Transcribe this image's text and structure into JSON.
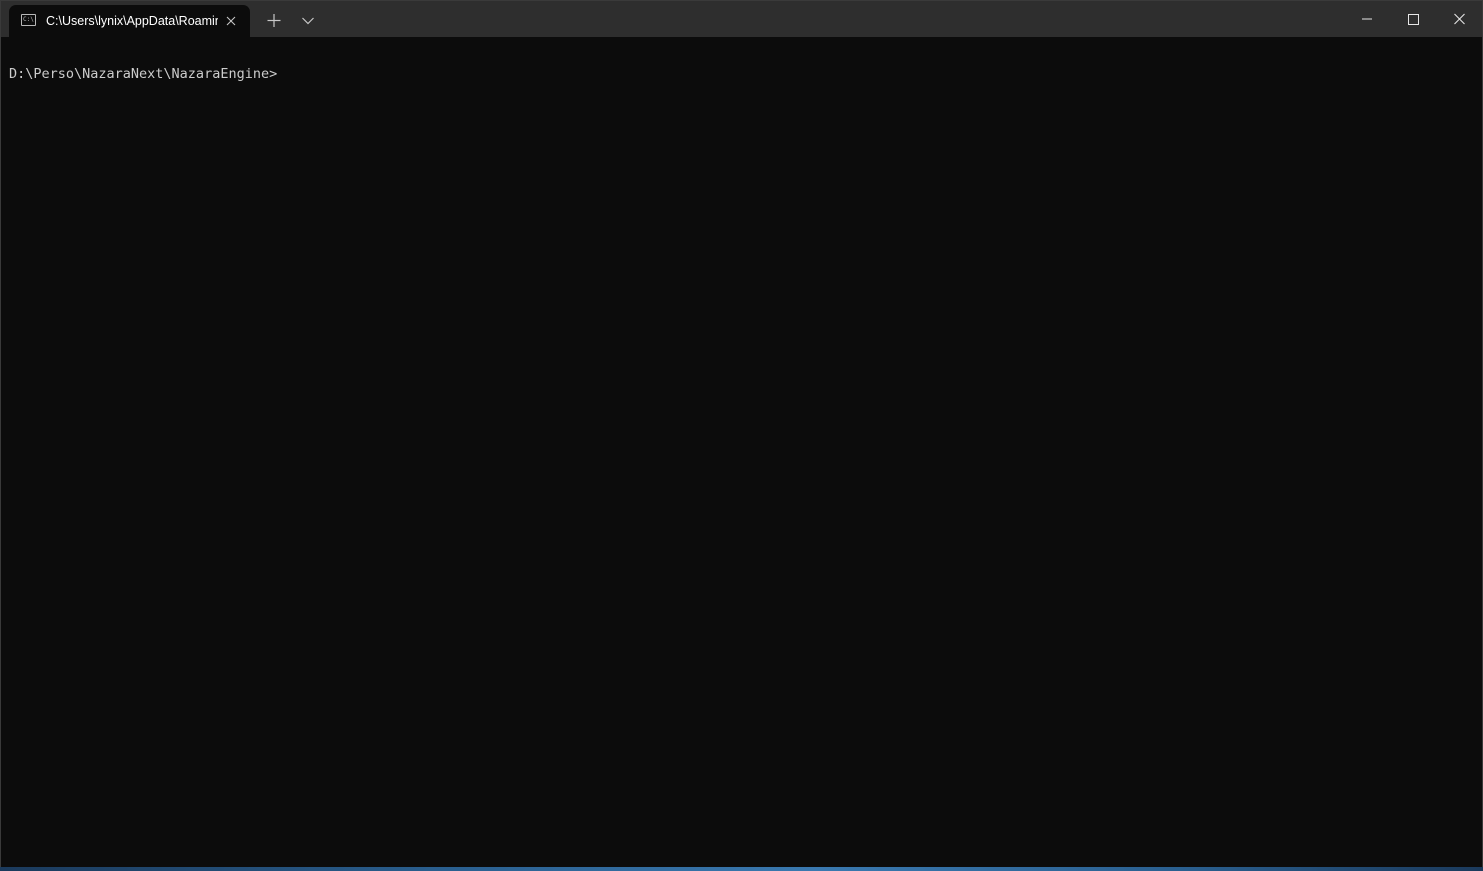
{
  "window": {
    "background": "#0c0c0c",
    "titlebar_color": "#2e2e2e"
  },
  "tabs": [
    {
      "title": "C:\\Users\\lynix\\AppData\\Roamin",
      "icon": "terminal-icon",
      "active": true
    }
  ],
  "toolbar": {
    "new_tab_icon": "plus-icon",
    "dropdown_icon": "chevron-down-icon"
  },
  "window_controls": {
    "minimize_icon": "minimize-icon",
    "maximize_icon": "maximize-icon",
    "close_icon": "close-icon"
  },
  "terminal": {
    "prompt": "D:\\Perso\\NazaraNext\\NazaraEngine>",
    "text_color": "#cccccc"
  }
}
